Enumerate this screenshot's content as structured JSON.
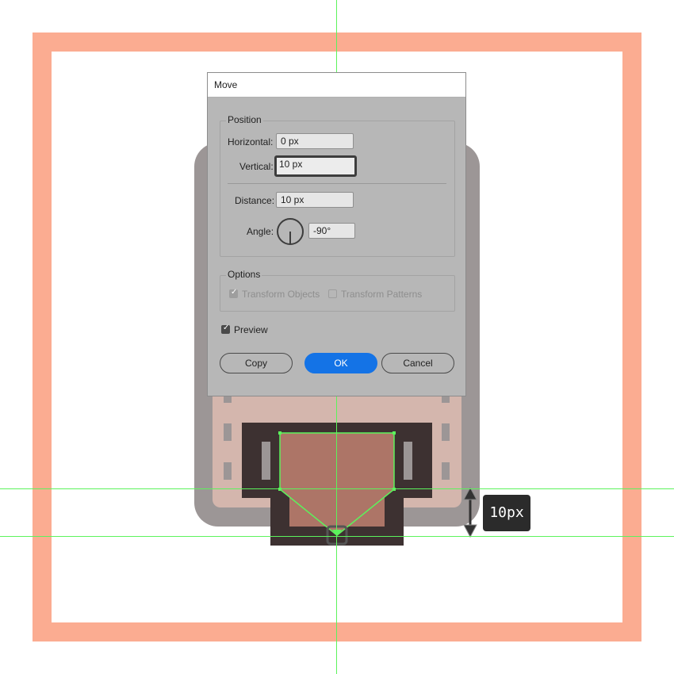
{
  "colors": {
    "artboard_border": "#fbac91",
    "guide": "#5cf35c",
    "dialog_bg": "#b7b7b7",
    "primary_button": "#1473e6",
    "artwork_dark": "#3d3131",
    "artwork_brown": "#ad7567"
  },
  "dialog": {
    "title": "Move",
    "position_group": {
      "label": "Position",
      "horizontal_label": "Horizontal:",
      "horizontal_value": "0 px",
      "vertical_label": "Vertical:",
      "vertical_value": "10 px",
      "distance_label": "Distance:",
      "distance_value": "10 px",
      "angle_label": "Angle:",
      "angle_value": "-90°"
    },
    "options_group": {
      "label": "Options",
      "transform_objects_label": "Transform Objects",
      "transform_objects_checked": true,
      "transform_patterns_label": "Transform Patterns",
      "transform_patterns_checked": false
    },
    "preview_label": "Preview",
    "preview_checked": true,
    "buttons": {
      "copy": "Copy",
      "ok": "OK",
      "cancel": "Cancel"
    }
  },
  "measure_tooltip": "10px",
  "icons": {
    "angle_dial": "angle-dial-icon",
    "double_arrow": "vertical-double-arrow-icon",
    "anchor": "anchor-point-icon"
  }
}
